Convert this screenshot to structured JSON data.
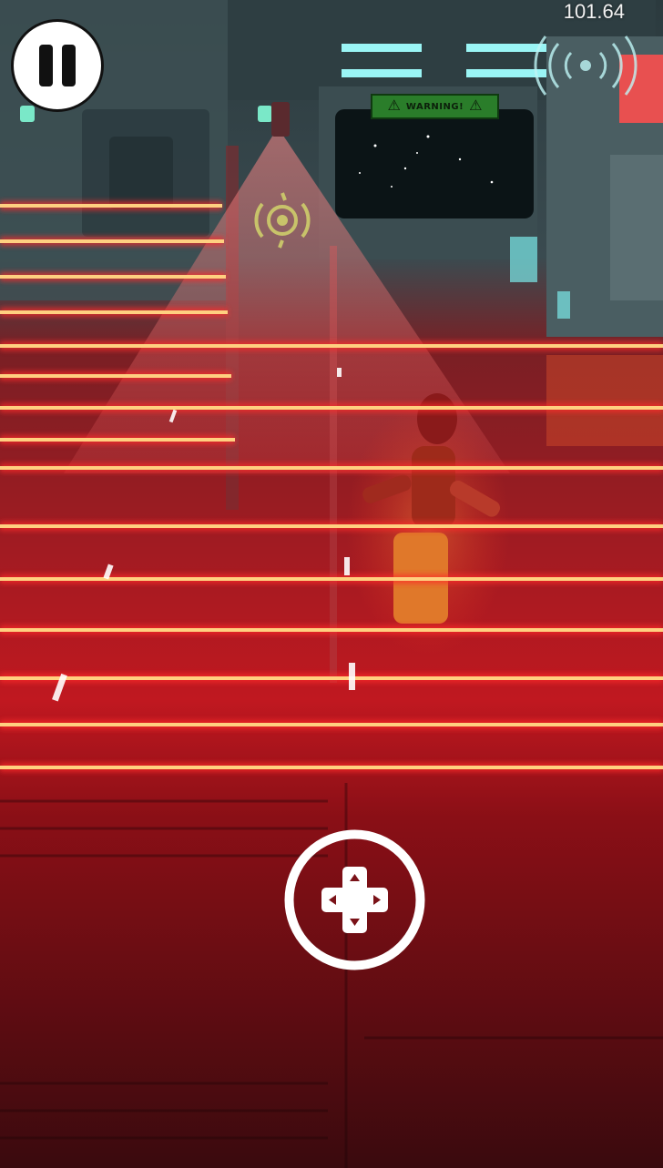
{
  "hud": {
    "timer": "101.64",
    "pause_icon": "pause-icon",
    "move_icon": "dpad-icon"
  },
  "scene": {
    "warning_sign": "WARNING!",
    "warning_icon": "warning-triangle-icon",
    "target_icon": "gear-target-icon",
    "signal_icon": "signal-broadcast-icon",
    "laser_color": "#ff2a2a",
    "laser_core_color": "#ffd080",
    "laser_count": 17
  },
  "colors": {
    "accent_cyan": "#6ff0f0",
    "floor_red": "#b3121b",
    "target_yellow": "#c8c36a"
  }
}
